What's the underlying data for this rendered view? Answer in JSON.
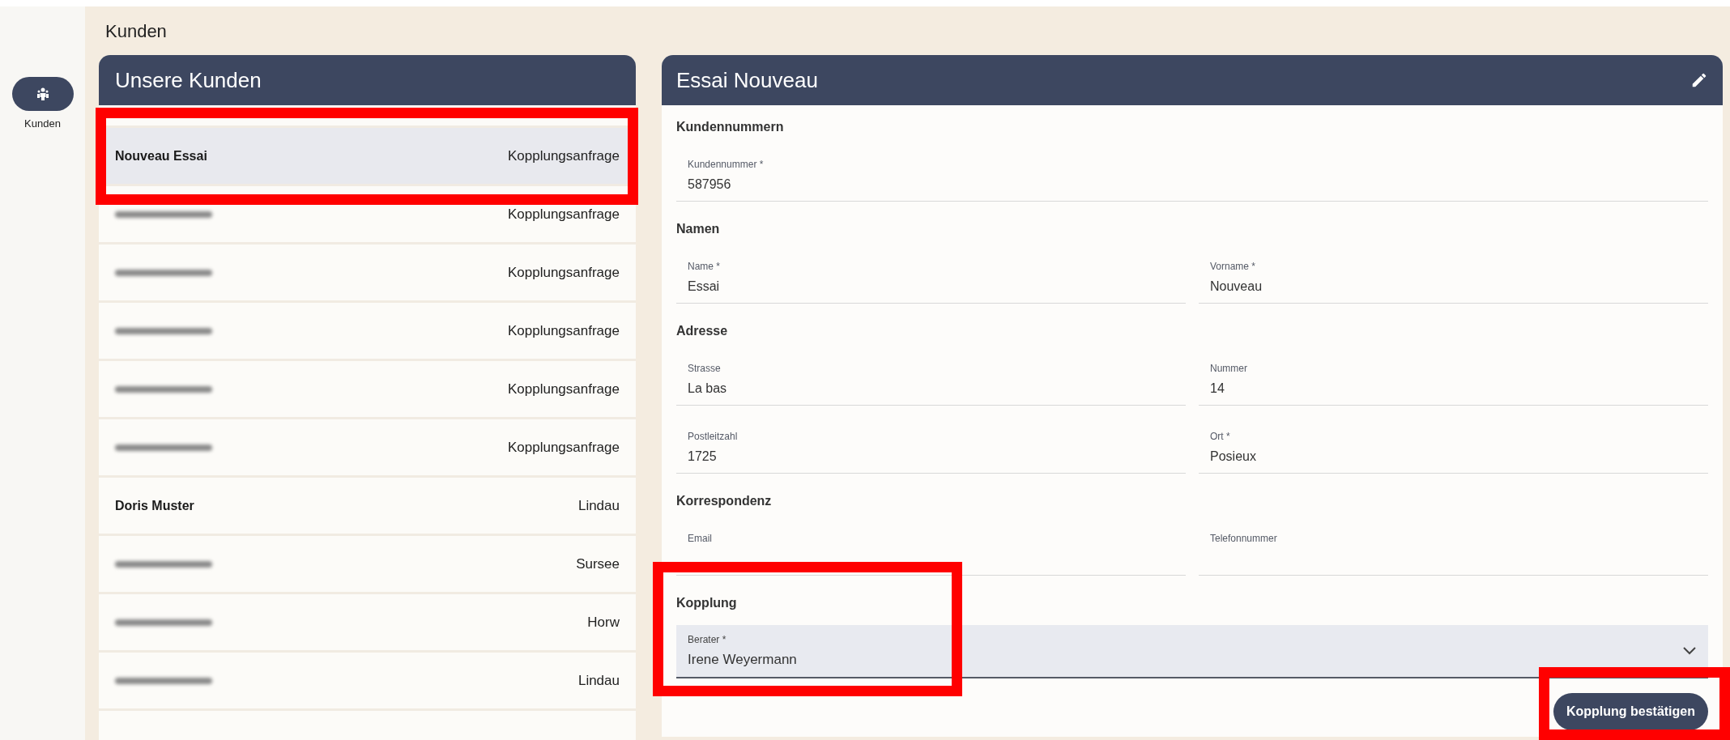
{
  "sidebar": {
    "items": [
      {
        "label": "Kunden",
        "selected": true
      }
    ]
  },
  "page_title": "Kunden",
  "customer_list": {
    "title": "Unsere Kunden",
    "rows": [
      {
        "kind": "named",
        "name": "Nouveau Essai",
        "status": "Kopplungsanfrage",
        "selected": true
      },
      {
        "kind": "redacted",
        "status": "Kopplungsanfrage",
        "selected": false
      },
      {
        "kind": "redacted",
        "status": "Kopplungsanfrage",
        "selected": false
      },
      {
        "kind": "redacted",
        "status": "Kopplungsanfrage",
        "selected": false
      },
      {
        "kind": "redacted",
        "status": "Kopplungsanfrage",
        "selected": false
      },
      {
        "kind": "redacted",
        "status": "Kopplungsanfrage",
        "selected": false
      },
      {
        "kind": "named",
        "name": "Doris Muster",
        "status": "Lindau",
        "selected": false
      },
      {
        "kind": "redacted",
        "status": "Sursee",
        "selected": false
      },
      {
        "kind": "redacted",
        "status": "Horw",
        "selected": false
      },
      {
        "kind": "redacted",
        "status": "Lindau",
        "selected": false
      }
    ]
  },
  "detail": {
    "title": "Essai Nouveau",
    "sections": [
      {
        "title": "Kundennummern",
        "fields": [
          {
            "label": "Kundennummer *",
            "value": "587956"
          }
        ]
      },
      {
        "title": "Namen",
        "fields": [
          {
            "label": "Name *",
            "value": "Essai"
          },
          {
            "label": "Vorname *",
            "value": "Nouveau"
          }
        ]
      },
      {
        "title": "Adresse",
        "fields": [
          {
            "label": "Strasse",
            "value": "La bas"
          },
          {
            "label": "Nummer",
            "value": "14"
          },
          {
            "label": "Postleitzahl",
            "value": "1725"
          },
          {
            "label": "Ort *",
            "value": "Posieux"
          }
        ]
      },
      {
        "title": "Korrespondenz",
        "fields": [
          {
            "label": "Email"
          },
          {
            "label": "Telefonnummer"
          }
        ]
      }
    ],
    "coupling": {
      "title": "Kopplung",
      "select": {
        "label": "Berater *",
        "value": "Irene Weyermann"
      }
    },
    "confirm_button": "Kopplung bestätigen"
  }
}
